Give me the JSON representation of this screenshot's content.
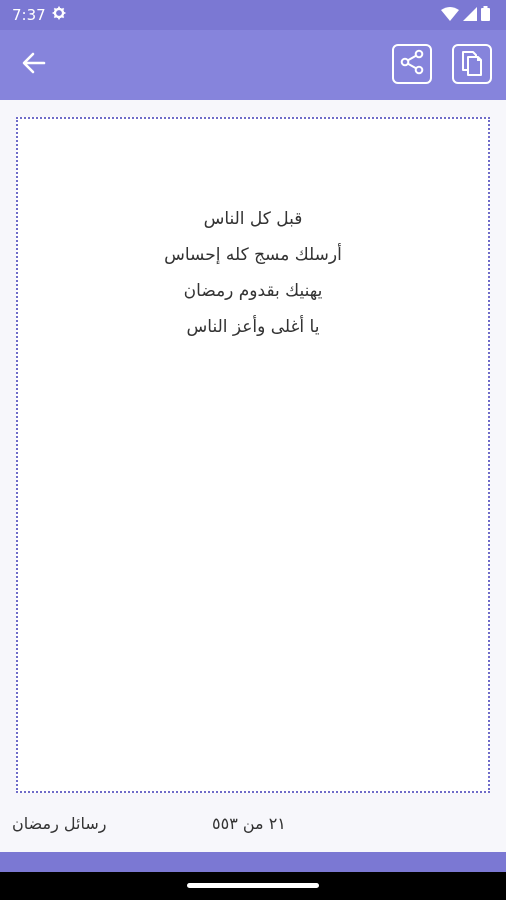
{
  "status_bar": {
    "time": "7:37",
    "icons": [
      "gear-icon",
      "wifi-icon",
      "signal-icon",
      "battery-icon"
    ]
  },
  "app_bar": {
    "back_icon": "arrow-left-icon",
    "actions": [
      "share-icon",
      "copy-icon"
    ]
  },
  "message": {
    "lines": [
      "قبل كل الناس",
      "أرسلك مسج كله إحساس",
      "يهنيك بقدوم رمضان",
      "يا أغلى وأعز الناس"
    ]
  },
  "footer": {
    "category": "رسائل رمضان",
    "counter": "٢١ من ٥٥٣"
  },
  "colors": {
    "status_bar": "#7b78d3",
    "app_bar": "#8684dc",
    "card_border": "#6f6cc9",
    "background": "#f7f7fb"
  }
}
